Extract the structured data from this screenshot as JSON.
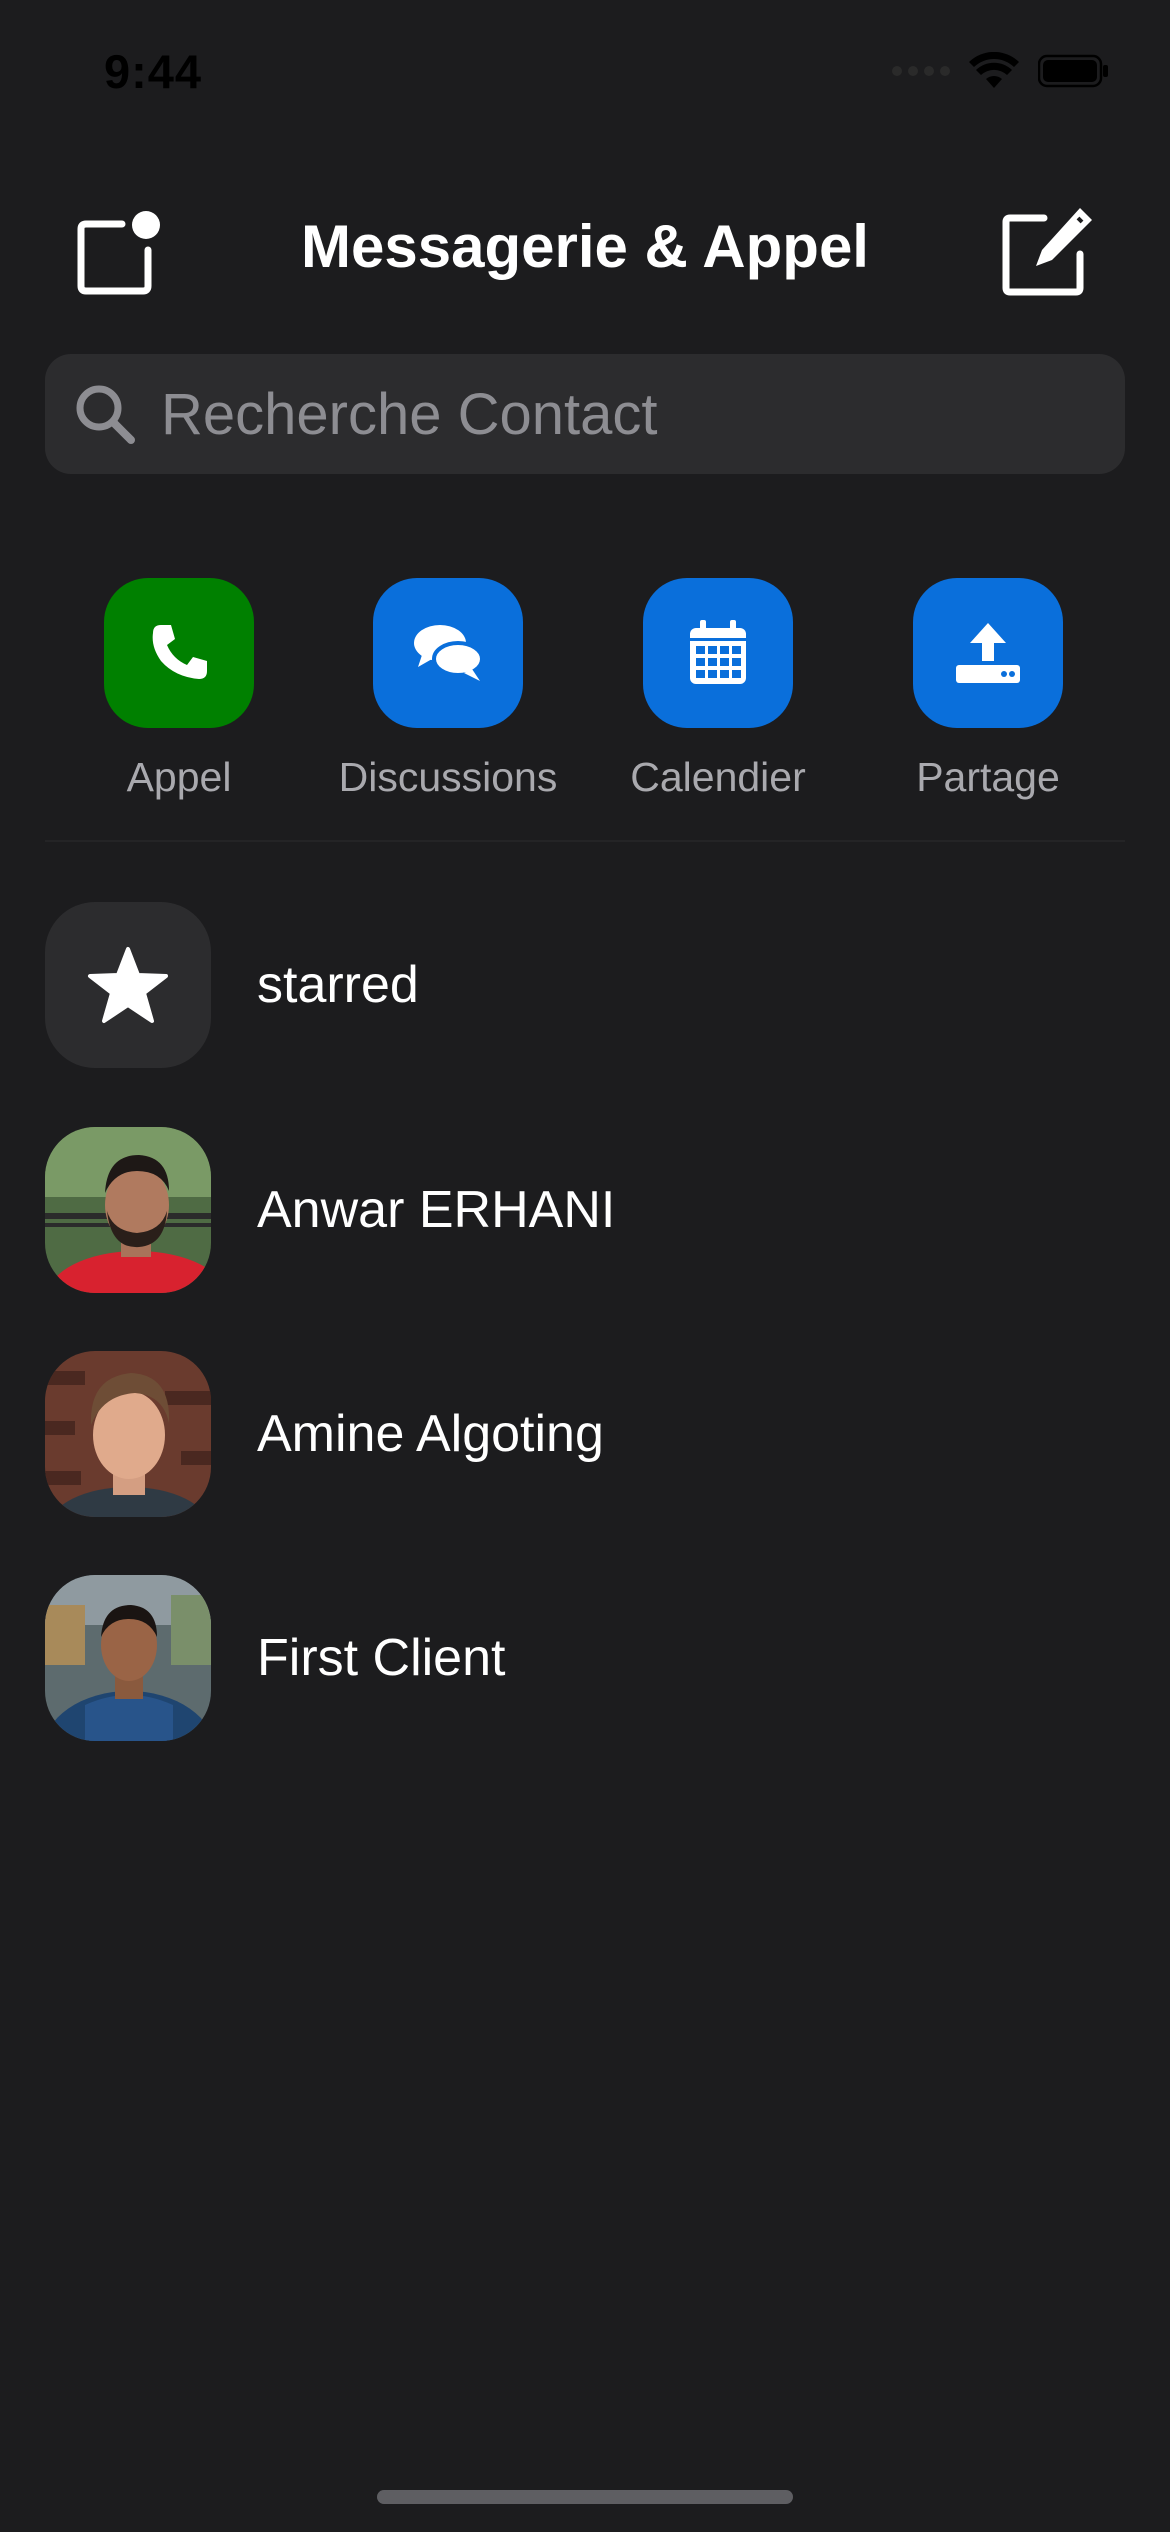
{
  "status_bar": {
    "time": "9:44",
    "icons": [
      "cellular-signal-icon",
      "wifi-icon",
      "battery-icon"
    ]
  },
  "header": {
    "title": "Messagerie & Appel",
    "left_icon": "notification-square-icon",
    "right_icon": "compose-icon"
  },
  "search": {
    "placeholder": "Recherche Contact",
    "value": "",
    "icon": "search-icon"
  },
  "quick_actions": [
    {
      "label": "Appel",
      "icon": "phone-icon",
      "color": "#008000"
    },
    {
      "label": "Discussions",
      "icon": "chat-bubbles-icon",
      "color": "#0a6fdb"
    },
    {
      "label": "Calendier",
      "icon": "calendar-icon",
      "color": "#0a6fdb"
    },
    {
      "label": "Partage",
      "icon": "upload-tray-icon",
      "color": "#0a6fdb"
    }
  ],
  "contacts": [
    {
      "name": "starred",
      "avatar": "star-icon"
    },
    {
      "name": "Anwar ERHANI",
      "avatar": "avatar-photo"
    },
    {
      "name": "Amine Algoting",
      "avatar": "avatar-photo"
    },
    {
      "name": "First Client",
      "avatar": "avatar-photo"
    }
  ],
  "colors": {
    "background": "#1c1c1e",
    "search_background": "#2c2c2e",
    "accent_blue": "#0a6fdb",
    "accent_green": "#008000"
  }
}
